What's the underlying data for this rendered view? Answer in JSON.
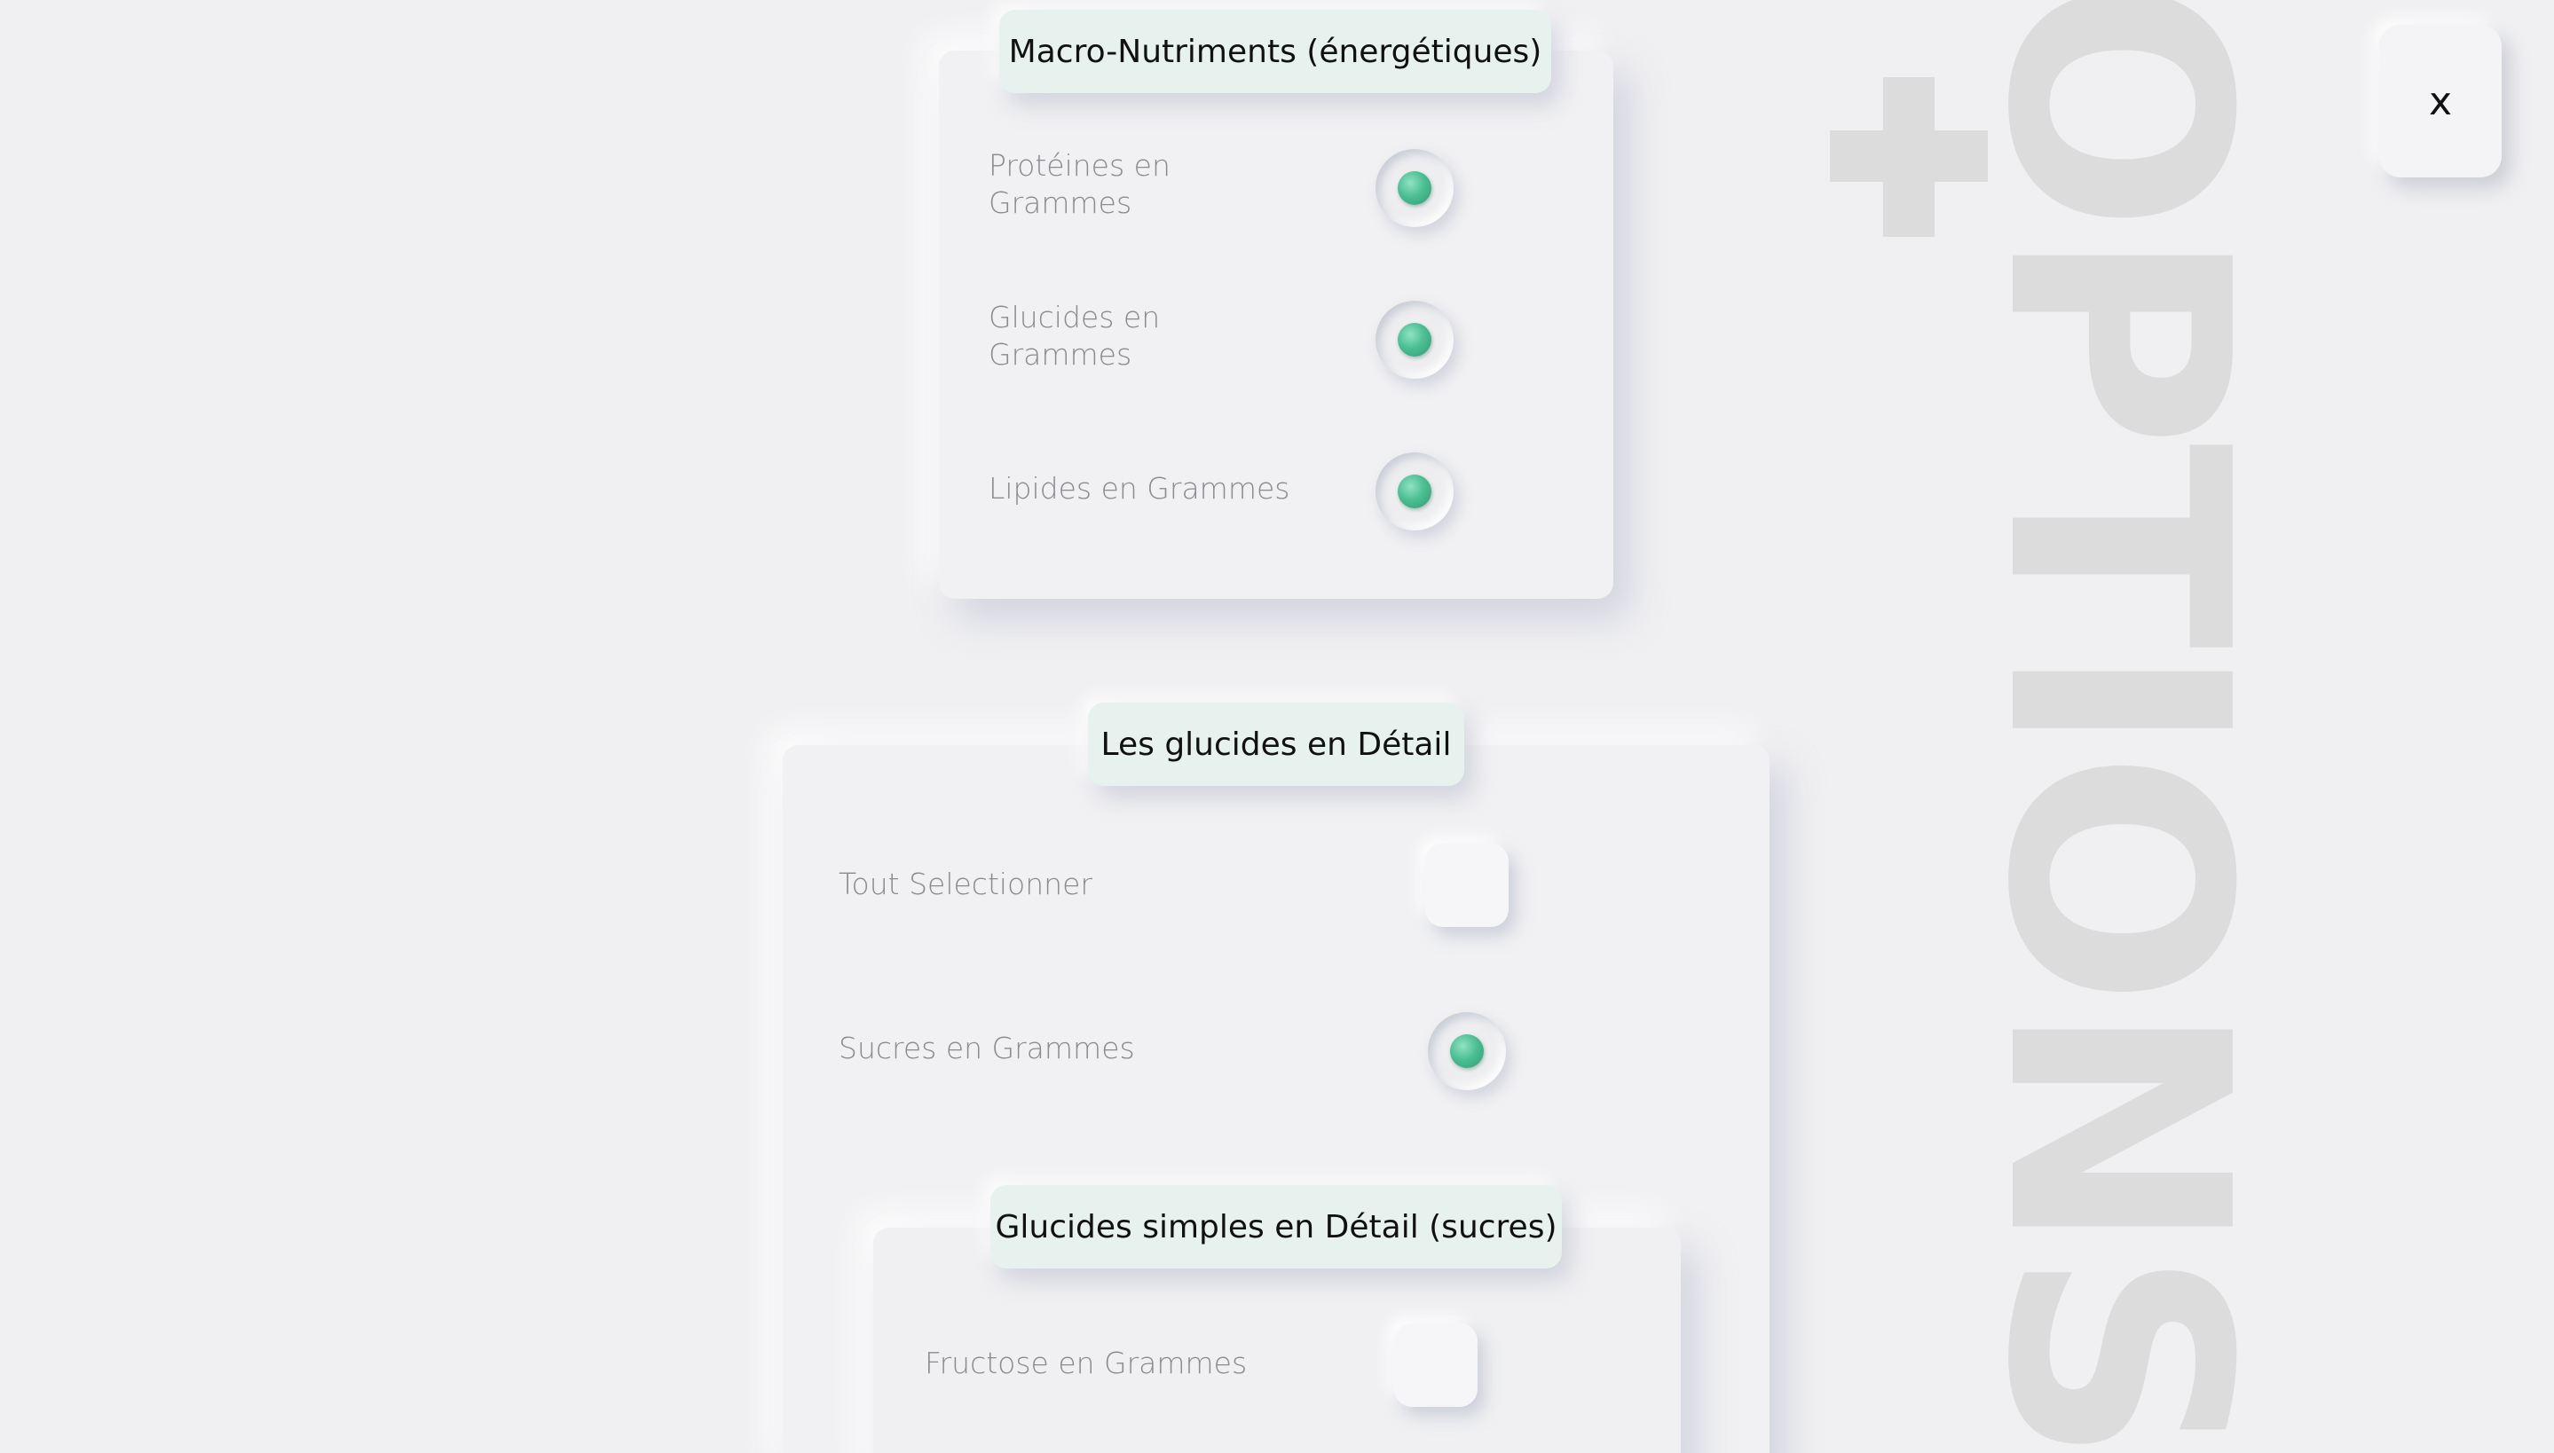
{
  "close_label": "x",
  "decoration": {
    "word": "OPTIONS",
    "symbol": "+"
  },
  "colors": {
    "background": "#f0f0f2",
    "accent_green": "#4dbf94",
    "tag_background": "#e7f2ee",
    "decoration_gray": "#dcdcdd"
  },
  "sections": {
    "macro": {
      "title": "Macro-Nutriments (énergétiques)",
      "items": [
        {
          "label_line1": "Protéines en",
          "label_line2": "Grammes",
          "selected": true
        },
        {
          "label_line1": "Glucides en",
          "label_line2": "Grammes",
          "selected": true
        },
        {
          "label": "Lipides en Grammes",
          "selected": true
        }
      ]
    },
    "glucides": {
      "title": "Les glucides en Détail",
      "items": [
        {
          "label": "Tout Selectionner",
          "selected": false
        },
        {
          "label": "Sucres en Grammes",
          "selected": true
        }
      ]
    },
    "sucres": {
      "title": "Glucides simples en Détail (sucres)",
      "items": [
        {
          "label": "Fructose en Grammes",
          "selected": false
        }
      ]
    }
  }
}
